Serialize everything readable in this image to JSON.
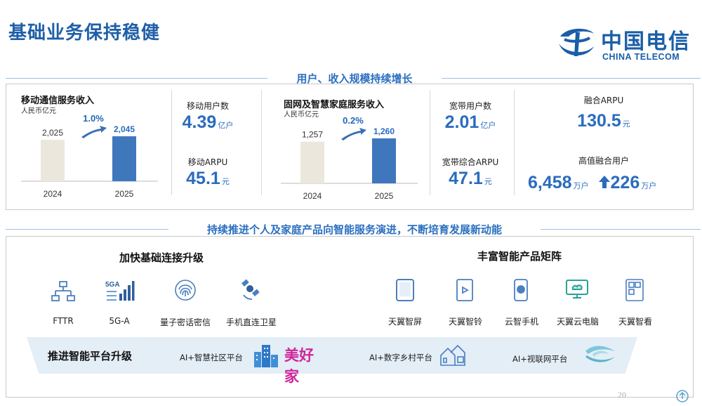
{
  "title": "基础业务保持稳健",
  "logo": {
    "cn": "中国电信",
    "en": "CHINA TELECOM"
  },
  "section1": "用户、收入规模持续增长",
  "mobile": {
    "title": "移动通信服务收入",
    "unit": "人民币亿元",
    "growth": "1.0%",
    "bars": [
      {
        "year": "2024",
        "value": 2025,
        "label": "2,025"
      },
      {
        "year": "2025",
        "value": 2045,
        "label": "2,045"
      }
    ]
  },
  "mobile_kpis": [
    {
      "label": "移动用户数",
      "value": "4.39",
      "unit": "亿户"
    },
    {
      "label": "移动ARPU",
      "value": "45.1",
      "unit": "元"
    }
  ],
  "fixed": {
    "title": "固网及智慧家庭服务收入",
    "unit": "人民币亿元",
    "growth": "0.2%",
    "bars": [
      {
        "year": "2024",
        "value": 1257,
        "label": "1,257"
      },
      {
        "year": "2025",
        "value": 1260,
        "label": "1,260"
      }
    ]
  },
  "fixed_kpis": [
    {
      "label": "宽带用户数",
      "value": "2.01",
      "unit": "亿户"
    },
    {
      "label": "宽带综合ARPU",
      "value": "47.1",
      "unit": "元"
    }
  ],
  "fusion": {
    "arpu_label": "融合ARPU",
    "arpu_value": "130.5",
    "arpu_unit": "元",
    "users_label": "高值融合用户",
    "users_value": "6,458",
    "users_unit": "万户",
    "inc_value": "226",
    "inc_unit": "万户"
  },
  "section2": "持续推进个人及家庭产品向智能服务演进，不断培育发展新动能",
  "connect": {
    "title": "加快基础连接升级",
    "items": [
      {
        "label": "FTTR",
        "icon": "network-topology-icon"
      },
      {
        "label": "5G-A",
        "icon": "5g-signal-icon",
        "badge": "5GA"
      },
      {
        "label": "量子密话密信",
        "icon": "fingerprint-icon"
      },
      {
        "label": "手机直连卫星",
        "icon": "satellite-icon"
      }
    ]
  },
  "products": {
    "title": "丰富智能产品矩阵",
    "items": [
      {
        "label": "天翼智屏",
        "icon": "tablet-icon"
      },
      {
        "label": "天翼智铃",
        "icon": "doorbell-icon"
      },
      {
        "label": "云智手机",
        "icon": "cloud-phone-icon"
      },
      {
        "label": "天翼云电脑",
        "icon": "cloud-pc-icon"
      },
      {
        "label": "天翼智看",
        "icon": "smart-view-icon"
      }
    ]
  },
  "platform": {
    "title": "推进智能平台升级",
    "items": [
      {
        "label": "AI+智慧社区平台",
        "icon": "buildings-icon",
        "brand": "美好家"
      },
      {
        "label": "AI+数字乡村平台",
        "icon": "village-icon"
      },
      {
        "label": "AI+视联网平台",
        "icon": "video-network-icon"
      }
    ]
  },
  "page_number": "20",
  "colors": {
    "accent": "#2a6cbf",
    "bar_prev": "#ebe7dc",
    "bar_curr": "#3f77bd",
    "bottom_bg": "#e3eef7"
  }
}
